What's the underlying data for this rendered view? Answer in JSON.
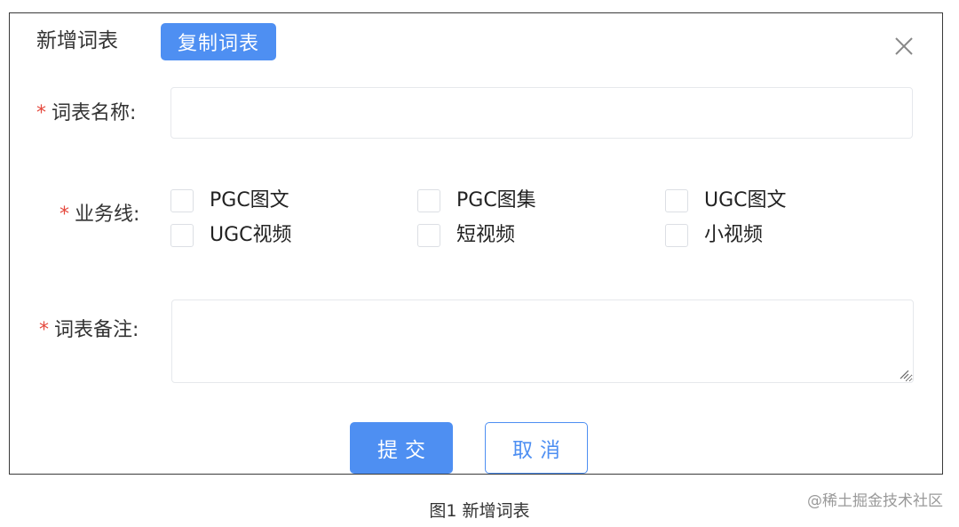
{
  "dialog": {
    "title": "新增词表",
    "copy_button": "复制词表",
    "close_icon": "close-icon"
  },
  "form": {
    "name_label": "词表名称:",
    "name_value": "",
    "business_label": "业务线:",
    "business_options": [
      "PGC图文",
      "PGC图集",
      "UGC图文",
      "UGC视频",
      "短视频",
      "小视频"
    ],
    "remark_label": "词表备注:",
    "remark_value": "",
    "required_mark": "*"
  },
  "actions": {
    "submit": "提交",
    "cancel": "取消"
  },
  "caption": "图1 新增词表",
  "watermark": "@稀土掘金技术社区",
  "colors": {
    "primary": "#4e8ff2",
    "required": "#e5483d",
    "border": "#e6e8ec"
  }
}
